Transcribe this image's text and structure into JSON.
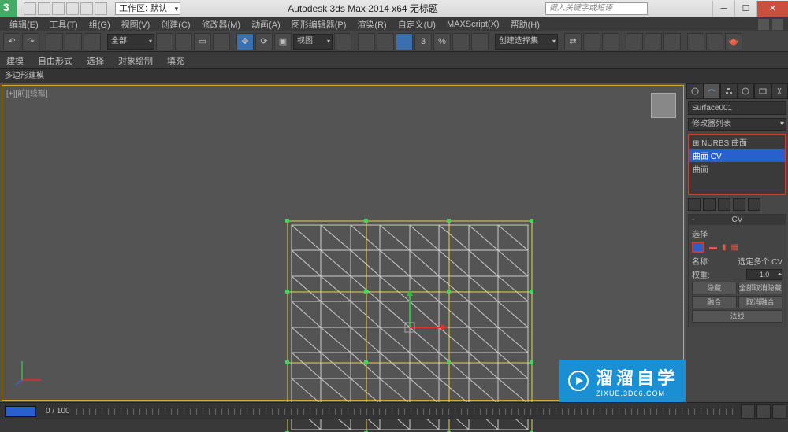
{
  "titlebar": {
    "workspace_label": "工作区: 默认",
    "title": "Autodesk 3ds Max  2014 x64     无标题",
    "search_placeholder": "键入关键字或短语"
  },
  "menubar": {
    "items": [
      "编辑(E)",
      "工具(T)",
      "组(G)",
      "视图(V)",
      "创建(C)",
      "修改器(M)",
      "动画(A)",
      "图形编辑器(P)",
      "渲染(R)",
      "自定义(U)",
      "MAXScript(X)",
      "帮助(H)"
    ]
  },
  "toolbar1": {
    "filter": "全部",
    "refsys": "视图",
    "selection_set": "创建选择集"
  },
  "toolbar2": {
    "items": [
      "建模",
      "自由形式",
      "选择",
      "对象绘制",
      "填充"
    ]
  },
  "tabbar": {
    "label": "多边形建模"
  },
  "viewport": {
    "label": "[+][前][线框]"
  },
  "cmdpanel": {
    "object_name": "Surface001",
    "modifier_list_label": "修改器列表",
    "stack": {
      "item0": "⊞ NURBS 曲面",
      "item1": "曲面 CV",
      "item2": "曲面"
    },
    "rollout_cv": {
      "title": "CV",
      "section_select": "选择",
      "name_label": "名称:",
      "name_value": "选定多个 CV",
      "weight_label": "权重:",
      "weight_value": "1.0",
      "btn_hide": "隐藏",
      "btn_unhideall": "全部取消隐藏",
      "btn_fuse": "融合",
      "btn_unfuse": "取消融合",
      "btn_remove_anim": "",
      "btn_constrained": "法线"
    }
  },
  "timeline": {
    "label": "0 / 100"
  },
  "watermark": {
    "text": "溜溜自学",
    "url": "ZIXUE.3D66.COM"
  }
}
